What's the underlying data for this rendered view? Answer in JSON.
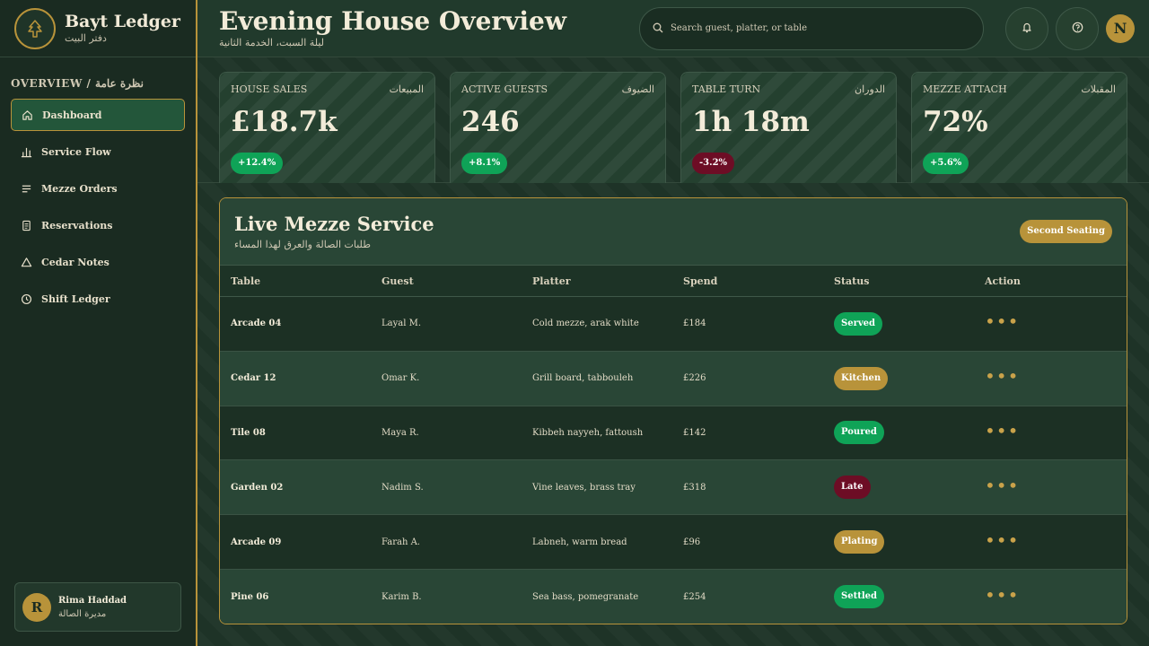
{
  "brand": {
    "name": "Bayt Ledger",
    "subtitle": "دفتر البيت",
    "icon": "cedar-tree-icon"
  },
  "sidebar": {
    "section_title": "OVERVIEW / نظرة عامة",
    "items": [
      {
        "label": "Dashboard",
        "icon": "home-icon",
        "active": true
      },
      {
        "label": "Service Flow",
        "icon": "bar-chart-icon",
        "active": false
      },
      {
        "label": "Mezze Orders",
        "icon": "list-icon",
        "active": false
      },
      {
        "label": "Reservations",
        "icon": "clipboard-icon",
        "active": false
      },
      {
        "label": "Cedar Notes",
        "icon": "triangle-icon",
        "active": false
      },
      {
        "label": "Shift Ledger",
        "icon": "clock-icon",
        "active": false
      }
    ],
    "user": {
      "initial": "R",
      "name": "Rima Haddad",
      "role": "مديرة الصالة"
    }
  },
  "header": {
    "title": "Evening House Overview",
    "subtitle": "ليلة السبت، الخدمة الثانية",
    "search_placeholder": "Search guest, platter, or table",
    "user_initial": "N"
  },
  "stats": [
    {
      "label": "HOUSE SALES",
      "label_ar": "المبيعات",
      "value": "£18.7k",
      "delta": "+12.4%",
      "trend": "up"
    },
    {
      "label": "ACTIVE GUESTS",
      "label_ar": "الضيوف",
      "value": "246",
      "delta": "+8.1%",
      "trend": "up"
    },
    {
      "label": "TABLE TURN",
      "label_ar": "الدوران",
      "value": "1h 18m",
      "delta": "-3.2%",
      "trend": "down"
    },
    {
      "label": "MEZZE ATTACH",
      "label_ar": "المقبلات",
      "value": "72%",
      "delta": "+5.6%",
      "trend": "up"
    }
  ],
  "panel": {
    "title": "Live Mezze Service",
    "subtitle": "طلبات الصالة والعرق لهذا المساء",
    "badge": "Second Seating",
    "columns": [
      "Table",
      "Guest",
      "Platter",
      "Spend",
      "Status",
      "Action"
    ],
    "rows": [
      {
        "table": "Arcade 04",
        "guest": "Layal M.",
        "platter": "Cold mezze, arak white",
        "spend": "£184",
        "status": "Served",
        "tone": "green"
      },
      {
        "table": "Cedar 12",
        "guest": "Omar K.",
        "platter": "Grill board, tabbouleh",
        "spend": "£226",
        "status": "Kitchen",
        "tone": "gold"
      },
      {
        "table": "Tile 08",
        "guest": "Maya R.",
        "platter": "Kibbeh nayyeh, fattoush",
        "spend": "£142",
        "status": "Poured",
        "tone": "green"
      },
      {
        "table": "Garden 02",
        "guest": "Nadim S.",
        "platter": "Vine leaves, brass tray",
        "spend": "£318",
        "status": "Late",
        "tone": "red"
      },
      {
        "table": "Arcade 09",
        "guest": "Farah A.",
        "platter": "Labneh, warm bread",
        "spend": "£96",
        "status": "Plating",
        "tone": "gold"
      },
      {
        "table": "Pine 06",
        "guest": "Karim B.",
        "platter": "Sea bass, pomegranate",
        "spend": "£254",
        "status": "Settled",
        "tone": "green"
      }
    ],
    "action_glyph": "•••"
  },
  "colors": {
    "accent_gold": "#b8933a",
    "success": "#0fa357",
    "danger": "#6d0d25",
    "background": "#1c2f25"
  }
}
